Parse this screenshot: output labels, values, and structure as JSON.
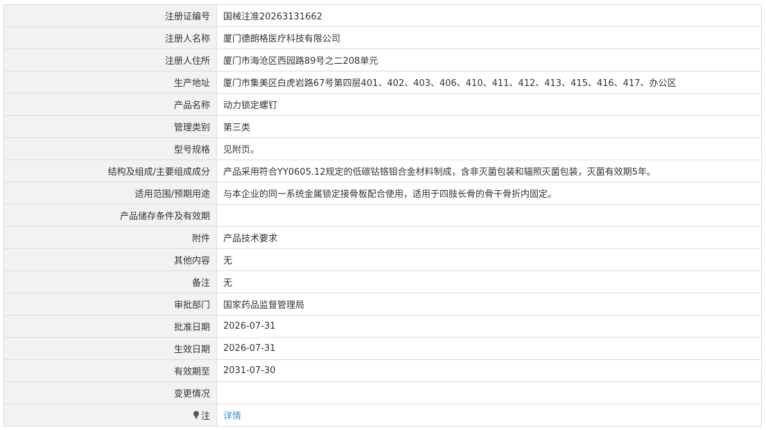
{
  "rows": [
    {
      "name": "registration-number",
      "label": "注册证编号",
      "value": "国械注准20263131662"
    },
    {
      "name": "registrant-name",
      "label": "注册人名称",
      "value": "厦门德朗格医疗科技有限公司"
    },
    {
      "name": "registrant-address",
      "label": "注册人住所",
      "value": "厦门市海沧区西园路89号之二208单元"
    },
    {
      "name": "production-address",
      "label": "生产地址",
      "value": "厦门市集美区白虎岩路67号第四层401、402、403、406、410、411、412、413、415、416、417、办公区"
    },
    {
      "name": "product-name",
      "label": "产品名称",
      "value": "动力锁定螺钉"
    },
    {
      "name": "management-category",
      "label": "管理类别",
      "value": "第三类"
    },
    {
      "name": "model-spec",
      "label": "型号规格",
      "value": "见附页。"
    },
    {
      "name": "structure-composition",
      "label": "结构及组成/主要组成成分",
      "value": "产品采用符合YY0605.12规定的低碳钴铬钼合金材料制成，含非灭菌包装和辐照灭菌包装，灭菌有效期5年。"
    },
    {
      "name": "intended-use",
      "label": "适用范围/预期用途",
      "value": "与本企业的同一系统金属锁定接骨板配合使用，适用于四肢长骨的骨干骨折内固定。"
    },
    {
      "name": "storage-conditions",
      "label": "产品储存条件及有效期",
      "value": ""
    },
    {
      "name": "attachment",
      "label": "附件",
      "value": "产品技术要求"
    },
    {
      "name": "other-content",
      "label": "其他内容",
      "value": "无"
    },
    {
      "name": "remarks",
      "label": "备注",
      "value": "无"
    },
    {
      "name": "approval-department",
      "label": "审批部门",
      "value": "国家药品监督管理局"
    },
    {
      "name": "approval-date",
      "label": "批准日期",
      "value": "2026-07-31"
    },
    {
      "name": "effective-date",
      "label": "生效日期",
      "value": "2026-07-31"
    },
    {
      "name": "valid-until",
      "label": "有效期至",
      "value": "2031-07-30"
    },
    {
      "name": "change-status",
      "label": "变更情况",
      "value": ""
    }
  ],
  "note": {
    "label": "注",
    "icon": "lightbulb-icon",
    "link_text": "详情",
    "link_color": "#3a8fd9"
  },
  "colors": {
    "label_bg": "#f2f2f2",
    "border": "#dcdcdc",
    "text": "#333333"
  }
}
